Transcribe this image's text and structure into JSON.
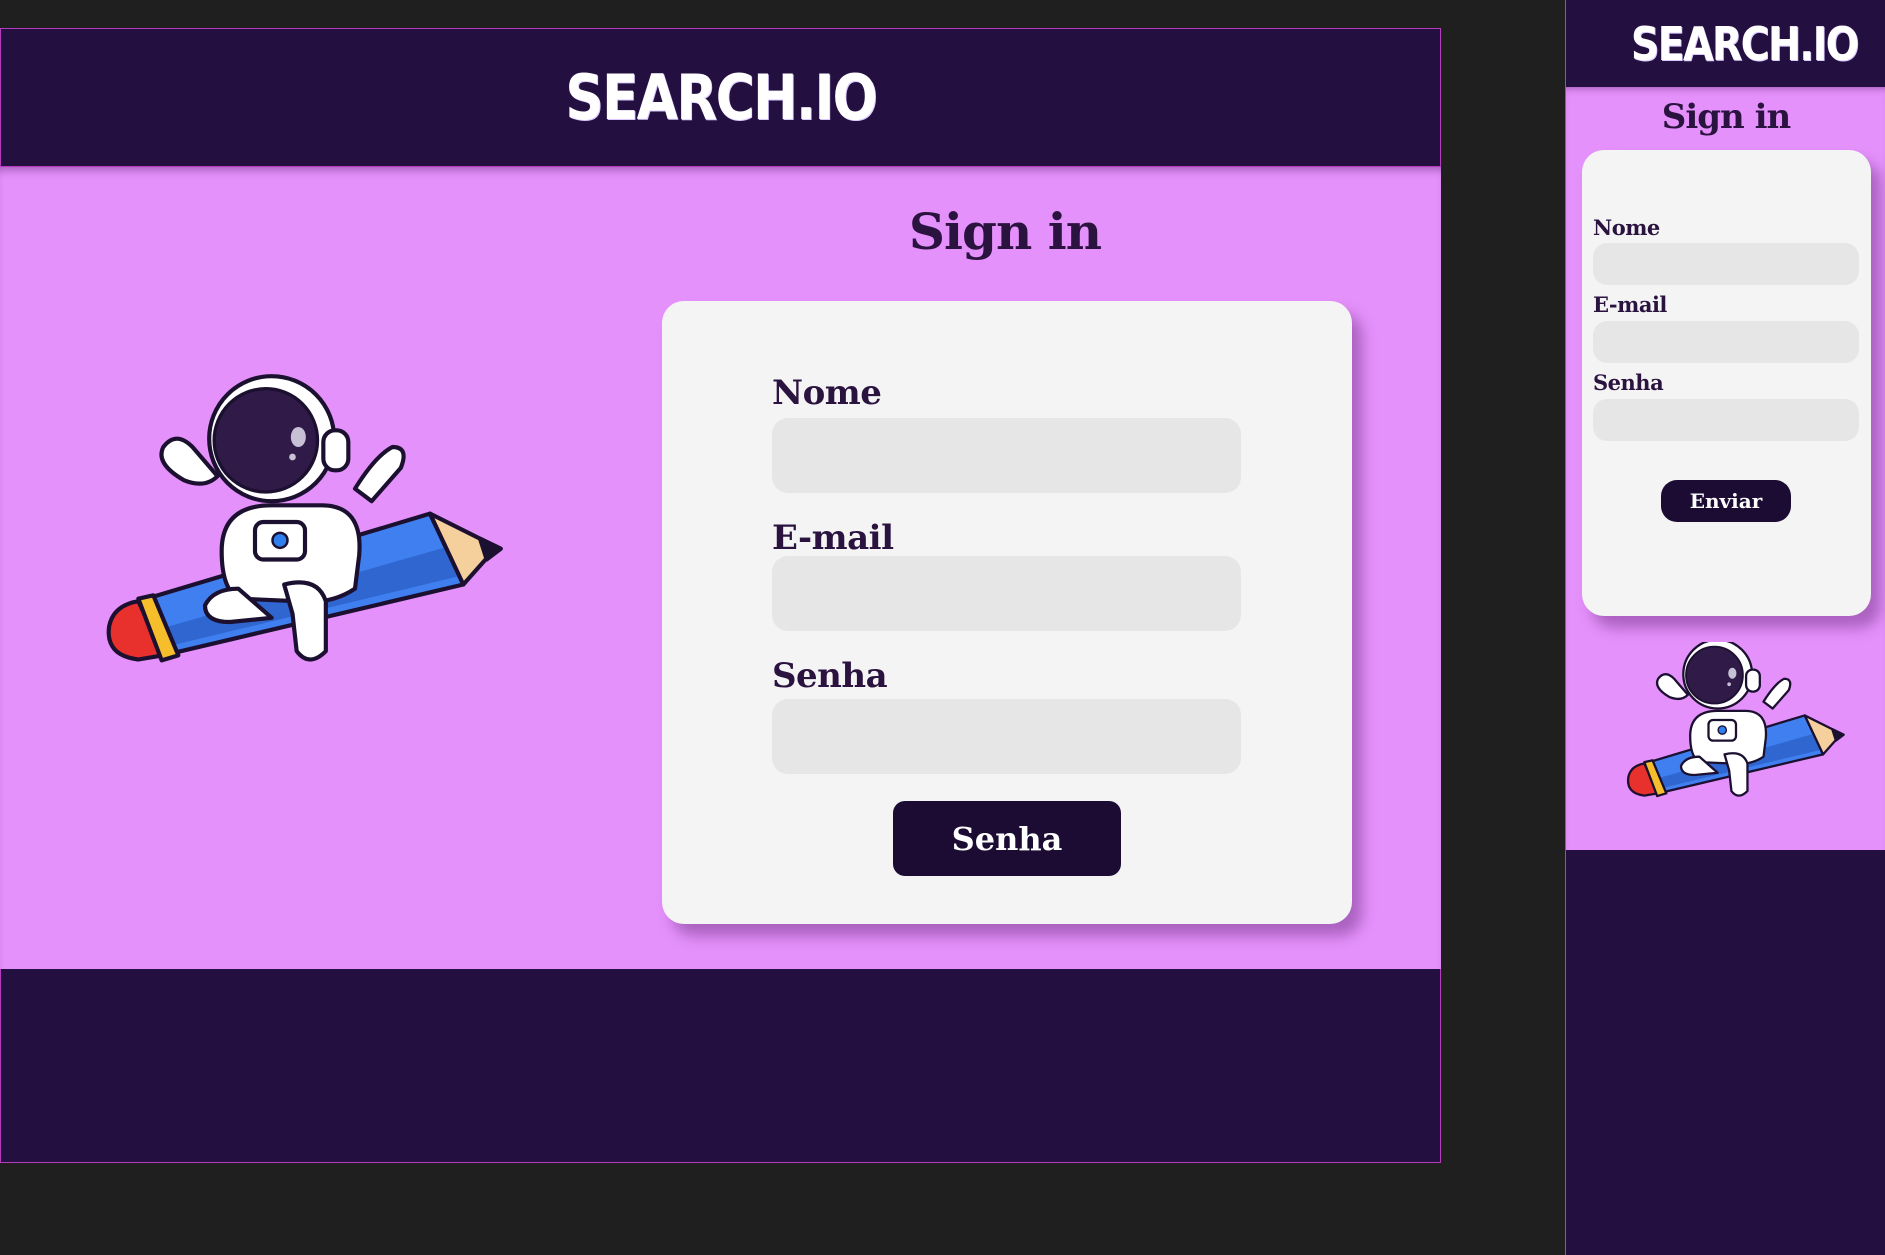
{
  "desktop": {
    "brand": "SEARCH.IO",
    "title": "Sign in",
    "form": {
      "name_label": "Nome",
      "email_label": "E-mail",
      "password_label": "Senha",
      "submit_label": "Senha"
    },
    "illustration": "astronaut-riding-pencil-illustration"
  },
  "mobile": {
    "brand": "SEARCH.IO",
    "title": "Sign in",
    "form": {
      "name_label": "Nome",
      "email_label": "E-mail",
      "password_label": "Senha",
      "submit_label": "Enviar"
    },
    "illustration": "astronaut-riding-pencil-illustration"
  },
  "colors": {
    "header_bg": "#241040",
    "main_bg": "#e591fb",
    "card_bg": "#f4f4f4",
    "input_bg": "#e6e6e6",
    "button_bg": "#1c0c33",
    "text_dark": "#2b1340"
  }
}
